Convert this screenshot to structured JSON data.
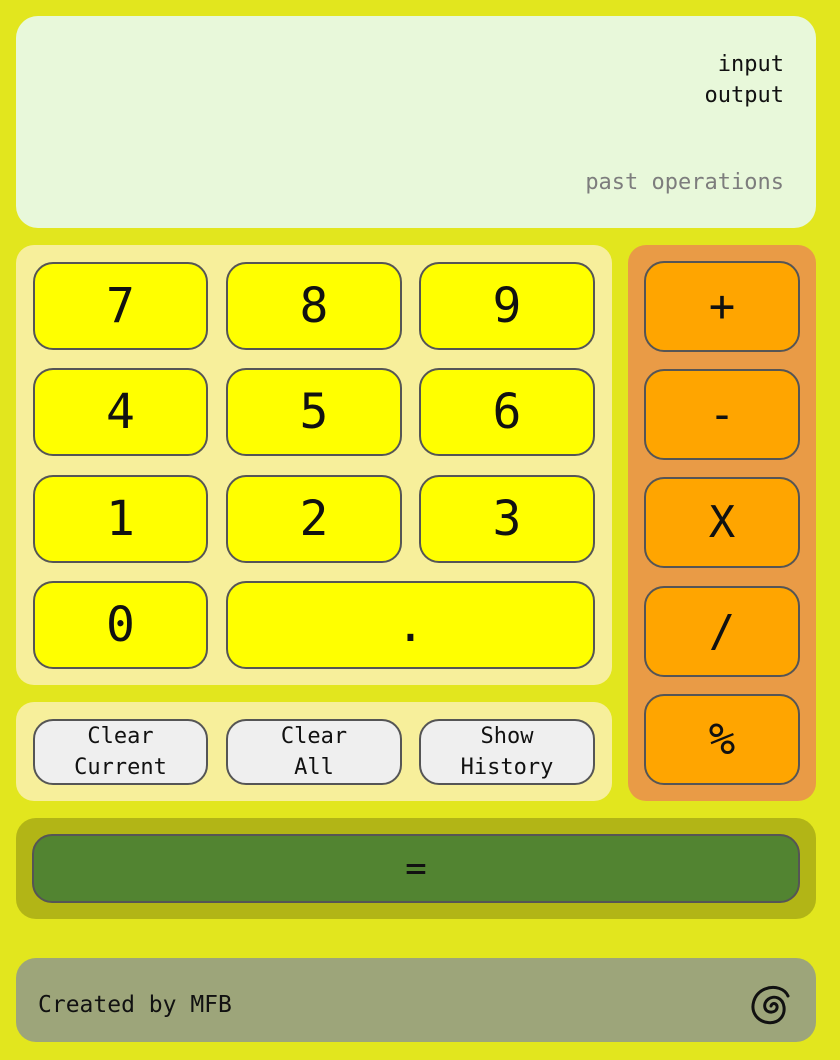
{
  "display": {
    "input": "input",
    "output": "output",
    "history": "past operations"
  },
  "keypad": {
    "digits": [
      "7",
      "8",
      "9",
      "4",
      "5",
      "6",
      "1",
      "2",
      "3",
      "0",
      "."
    ]
  },
  "controls": {
    "clear_current": "Clear\nCurrent",
    "clear_all": "Clear\nAll",
    "show_history": "Show\nHistory"
  },
  "operators": [
    "+",
    "-",
    "X",
    "/",
    "%"
  ],
  "equals": "=",
  "footer": {
    "credit": "Created by MFB",
    "logo_icon": "swirl-icon"
  },
  "colors": {
    "background": "#e2e61e",
    "display": "#e8f8da",
    "digit_button": "#ffff00",
    "operator_button": "#ffa500",
    "operator_panel": "#e99b46",
    "equals_button": "#528431",
    "footer": "#9da57a"
  }
}
